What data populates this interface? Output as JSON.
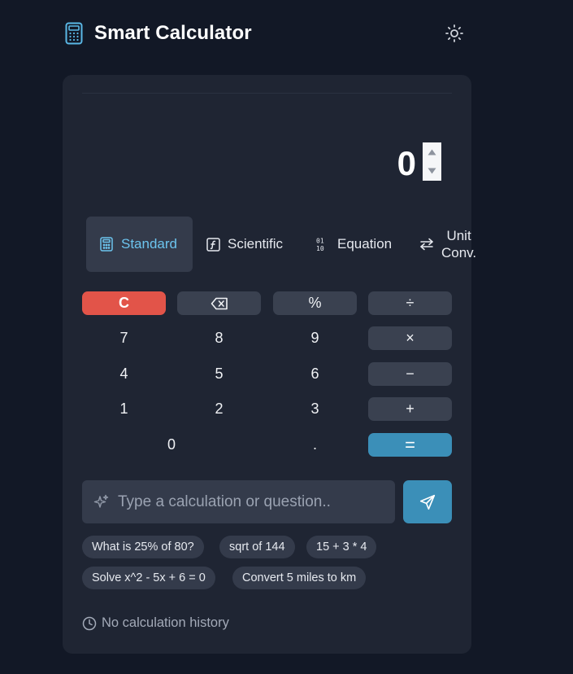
{
  "header": {
    "title": "Smart Calculator",
    "logo_icon": "calculator-icon",
    "theme_icon": "sun-icon"
  },
  "display": {
    "value": "0"
  },
  "tabs": [
    {
      "label": "Standard",
      "icon": "calculator-icon",
      "active": true
    },
    {
      "label": "Scientific",
      "icon": "function-icon",
      "active": false
    },
    {
      "label": "Equation",
      "icon": "binary-icon",
      "active": false
    },
    {
      "label_line1": "Unit",
      "label_line2": "Conv.",
      "icon": "swap-icon",
      "active": false
    }
  ],
  "keypad": {
    "clear": "C",
    "percent": "%",
    "divide": "÷",
    "multiply": "×",
    "minus": "−",
    "plus": "+",
    "equals": "=",
    "seven": "7",
    "eight": "8",
    "nine": "9",
    "four": "4",
    "five": "5",
    "six": "6",
    "one": "1",
    "two": "2",
    "three": "3",
    "zero": "0",
    "dot": "."
  },
  "ask": {
    "placeholder": "Type a calculation or question.."
  },
  "suggestions": [
    "What is 25% of 80?",
    "sqrt of 144",
    "15 + 3 * 4",
    "Solve x^2 - 5x + 6 = 0",
    "Convert 5 miles to km"
  ],
  "history": {
    "empty_text": "No calculation history"
  },
  "colors": {
    "background": "#121826",
    "card": "#1f2533",
    "accent": "#3b8fb8",
    "active_tab_text": "#6cc4ee",
    "clear_button": "#e25449"
  }
}
